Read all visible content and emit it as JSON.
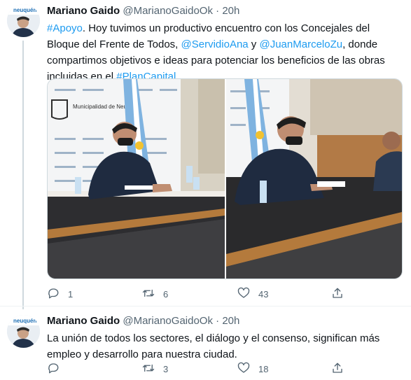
{
  "tweets": [
    {
      "author_name": "Mariano Gaido",
      "handle": "@MarianoGaidoOk",
      "separator": "·",
      "time": "20h",
      "text_parts": {
        "t1": "#Apoyo",
        "t2": ". Hoy tuvimos un productivo encuentro con los Concejales del Bloque del Frente de Todos, ",
        "t3": "@ServidioAna",
        "t4": " y ",
        "t5": "@JuanMarceloZu",
        "t6": ", donde compartimos objetivos e ideas para potenciar los beneficios de las obras incluidas en el ",
        "t7": "#PlanCapital",
        "t8": "."
      },
      "media_sign_text": "Municipalidad de Neuquén",
      "avatar_text": "neuquén",
      "replies": "1",
      "retweets": "6",
      "likes": "43"
    },
    {
      "author_name": "Mariano Gaido",
      "handle": "@MarianoGaidoOk",
      "separator": "·",
      "time": "20h",
      "text": "La unión de todos los sectores, el diálogo y el consenso, significan más empleo y desarrollo para nuestra ciudad.",
      "avatar_text": "neuquén",
      "replies": "",
      "retweets": "3",
      "likes": "18"
    }
  ],
  "colors": {
    "link": "#1d9bf0",
    "secondary_text": "#536471",
    "thread_line": "#cfd9de"
  },
  "icons": [
    "reply-icon",
    "retweet-icon",
    "like-icon",
    "share-icon"
  ]
}
